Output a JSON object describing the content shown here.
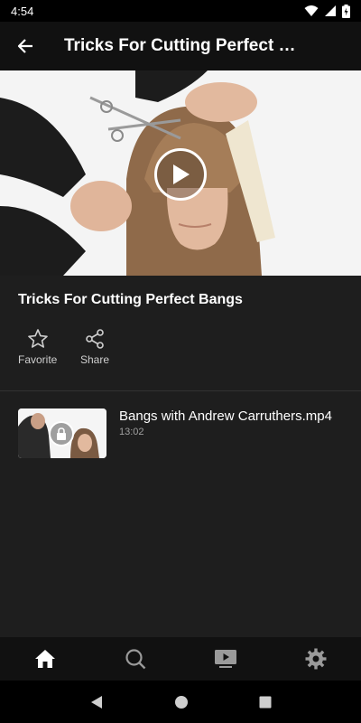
{
  "status_bar": {
    "time": "4:54"
  },
  "app_bar": {
    "title": "Tricks For Cutting Perfect B..."
  },
  "course": {
    "title": "Tricks For Cutting Perfect Bangs"
  },
  "actions": {
    "favorite_label": "Favorite",
    "share_label": "Share"
  },
  "videos": [
    {
      "title": "Bangs with Andrew Carruthers.mp4",
      "duration": "13:02",
      "locked": true
    }
  ],
  "bottom_nav": {
    "items": [
      {
        "icon": "home-icon",
        "active": true
      },
      {
        "icon": "search-icon",
        "active": false
      },
      {
        "icon": "video-library-icon",
        "active": false
      },
      {
        "icon": "settings-gear-icon",
        "active": false
      }
    ]
  },
  "colors": {
    "background": "#1e1e1e",
    "bar": "#111111",
    "inactive_icon": "#9a9a9a",
    "text_secondary": "#a0a0a0"
  }
}
